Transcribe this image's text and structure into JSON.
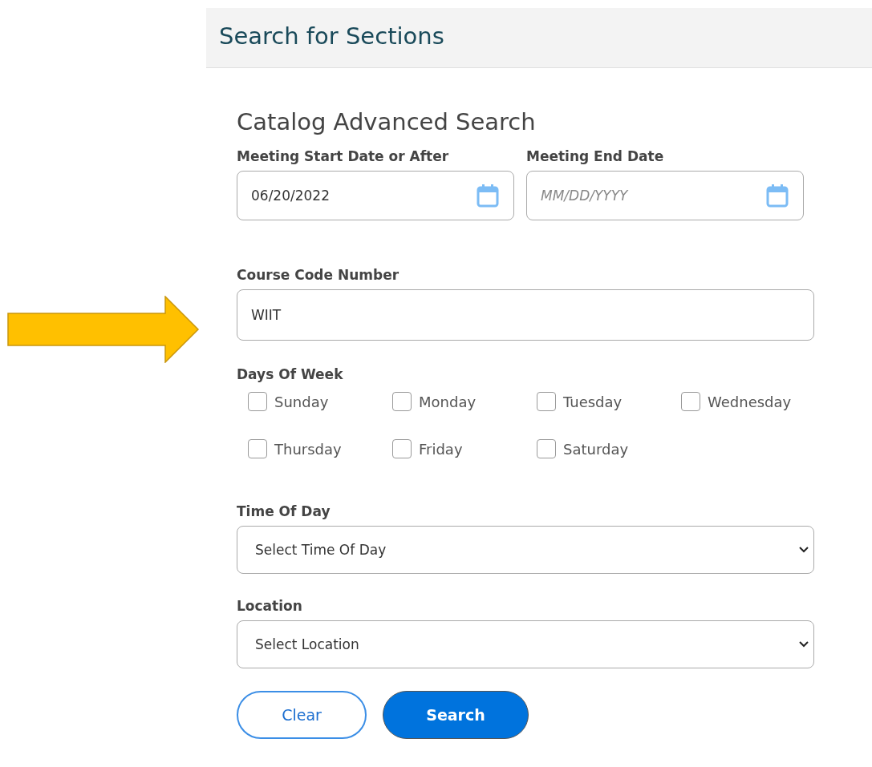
{
  "header": {
    "title": "Search for Sections"
  },
  "form": {
    "title": "Catalog Advanced Search",
    "start_date": {
      "label": "Meeting Start Date or After",
      "value": "06/20/2022"
    },
    "end_date": {
      "label": "Meeting End Date",
      "placeholder": "MM/DD/YYYY"
    },
    "course_code": {
      "label": "Course Code Number",
      "value": "WIIT"
    },
    "days": {
      "label": "Days Of Week",
      "items": [
        {
          "label": "Sunday",
          "checked": false
        },
        {
          "label": "Monday",
          "checked": false
        },
        {
          "label": "Tuesday",
          "checked": false
        },
        {
          "label": "Wednesday",
          "checked": false
        },
        {
          "label": "Thursday",
          "checked": false
        },
        {
          "label": "Friday",
          "checked": false
        },
        {
          "label": "Saturday",
          "checked": false
        }
      ]
    },
    "time_of_day": {
      "label": "Time Of Day",
      "value": "Select Time Of Day"
    },
    "location": {
      "label": "Location",
      "value": "Select Location"
    },
    "buttons": [
      {
        "label": "Clear",
        "kind": "secondary"
      },
      {
        "label": "Search",
        "kind": "primary"
      }
    ]
  }
}
